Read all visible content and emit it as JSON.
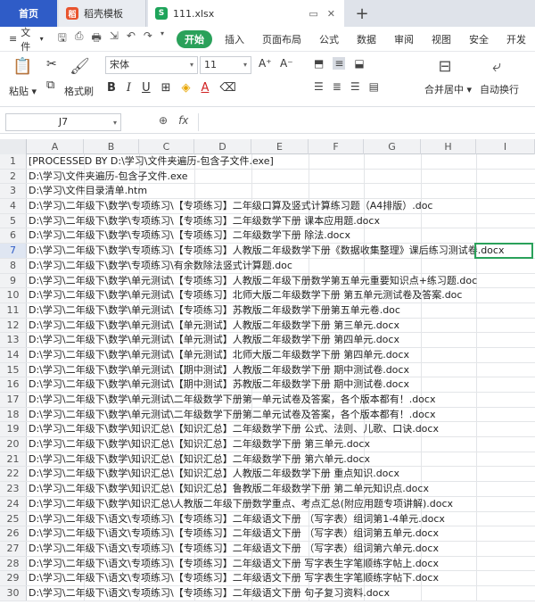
{
  "tabs": {
    "home": "首页",
    "doc": "稻壳模板",
    "doc_icon": "稻",
    "file": "111.xlsx",
    "file_icon": "S",
    "new_tab": "+"
  },
  "menu": {
    "file_label": "文件",
    "items": [
      "开始",
      "插入",
      "页面布局",
      "公式",
      "数据",
      "审阅",
      "视图",
      "安全",
      "开发"
    ]
  },
  "ribbon": {
    "paste": "粘贴",
    "format_painter": "格式刷",
    "font": "宋体",
    "size": "11",
    "merge": "合并居中",
    "wrap": "自动换行"
  },
  "formula_bar": {
    "cell_ref": "J7",
    "fx_label": "fx"
  },
  "columns": [
    "A",
    "B",
    "C",
    "D",
    "E",
    "F",
    "G",
    "H",
    "I"
  ],
  "rows": [
    {
      "n": "1",
      "text": "[PROCESSED BY D:\\学习\\文件夹遍历-包含子文件.exe]"
    },
    {
      "n": "2",
      "text": "D:\\学习\\文件夹遍历-包含子文件.exe"
    },
    {
      "n": "3",
      "text": "D:\\学习\\文件目录清单.htm"
    },
    {
      "n": "4",
      "text": "D:\\学习\\二年级下\\数学\\专项练习\\【专项练习】二年级口算及竖式计算练习题（A4排版）.doc"
    },
    {
      "n": "5",
      "text": "D:\\学习\\二年级下\\数学\\专项练习\\【专项练习】二年级数学下册 课本应用题.docx"
    },
    {
      "n": "6",
      "text": "D:\\学习\\二年级下\\数学\\专项练习\\【专项练习】二年级数学下册 除法.docx"
    },
    {
      "n": "7",
      "text": "D:\\学习\\二年级下\\数学\\专项练习\\【专项练习】人教版二年级数学下册《数据收集整理》课后练习测试卷.docx"
    },
    {
      "n": "8",
      "text": "D:\\学习\\二年级下\\数学\\专项练习\\有余数除法竖式计算题.doc"
    },
    {
      "n": "9",
      "text": "D:\\学习\\二年级下\\数学\\单元测试\\【专项练习】人教版二年级下册数学第五单元重要知识点+练习题.doc"
    },
    {
      "n": "10",
      "text": "D:\\学习\\二年级下\\数学\\单元测试\\【专项练习】北师大版二年级数学下册 第五单元测试卷及答案.doc"
    },
    {
      "n": "11",
      "text": "D:\\学习\\二年级下\\数学\\单元测试\\【专项练习】苏教版二年级数学下册第五单元卷.doc"
    },
    {
      "n": "12",
      "text": "D:\\学习\\二年级下\\数学\\单元测试\\【单元测试】人教版二年级数学下册 第三单元.docx"
    },
    {
      "n": "13",
      "text": "D:\\学习\\二年级下\\数学\\单元测试\\【单元测试】人教版二年级数学下册 第四单元.docx"
    },
    {
      "n": "14",
      "text": "D:\\学习\\二年级下\\数学\\单元测试\\【单元测试】北师大版二年级数学下册 第四单元.docx"
    },
    {
      "n": "15",
      "text": "D:\\学习\\二年级下\\数学\\单元测试\\【期中测试】人教版二年级数学下册 期中测试卷.docx"
    },
    {
      "n": "16",
      "text": "D:\\学习\\二年级下\\数学\\单元测试\\【期中测试】苏教版二年级数学下册 期中测试卷.docx"
    },
    {
      "n": "17",
      "text": "D:\\学习\\二年级下\\数学\\单元测试\\二年级数学下册第一单元试卷及答案，各个版本都有！.docx"
    },
    {
      "n": "18",
      "text": "D:\\学习\\二年级下\\数学\\单元测试\\二年级数学下册第二单元试卷及答案，各个版本都有！.docx"
    },
    {
      "n": "19",
      "text": "D:\\学习\\二年级下\\数学\\知识汇总\\【知识汇总】二年级数学下册 公式、法则、儿歌、口诀.docx"
    },
    {
      "n": "20",
      "text": "D:\\学习\\二年级下\\数学\\知识汇总\\【知识汇总】二年级数学下册 第三单元.docx"
    },
    {
      "n": "21",
      "text": "D:\\学习\\二年级下\\数学\\知识汇总\\【知识汇总】二年级数学下册 第六单元.docx"
    },
    {
      "n": "22",
      "text": "D:\\学习\\二年级下\\数学\\知识汇总\\【知识汇总】人教版二年级数学下册 重点知识.docx"
    },
    {
      "n": "23",
      "text": "D:\\学习\\二年级下\\数学\\知识汇总\\【知识汇总】鲁教版二年级数学下册 第二单元知识点.docx"
    },
    {
      "n": "24",
      "text": "D:\\学习\\二年级下\\数学\\知识汇总\\人教版二年级下册数学重点、考点汇总(附应用题专项讲解).docx"
    },
    {
      "n": "25",
      "text": "D:\\学习\\二年级下\\语文\\专项练习\\【专项练习】二年级语文下册 （写字表）组词第1-4单元.docx"
    },
    {
      "n": "26",
      "text": "D:\\学习\\二年级下\\语文\\专项练习\\【专项练习】二年级语文下册 （写字表）组词第五单元.docx"
    },
    {
      "n": "27",
      "text": "D:\\学习\\二年级下\\语文\\专项练习\\【专项练习】二年级语文下册 （写字表）组词第六单元.docx"
    },
    {
      "n": "28",
      "text": "D:\\学习\\二年级下\\语文\\专项练习\\【专项练习】二年级语文下册 写字表生字笔顺练字帖上.docx"
    },
    {
      "n": "29",
      "text": "D:\\学习\\二年级下\\语文\\专项练习\\【专项练习】二年级语文下册 写字表生字笔顺练字帖下.docx"
    },
    {
      "n": "30",
      "text": "D:\\学习\\二年级下\\语文\\专项练习\\【专项练习】二年级语文下册 句子复习资料.docx"
    }
  ]
}
